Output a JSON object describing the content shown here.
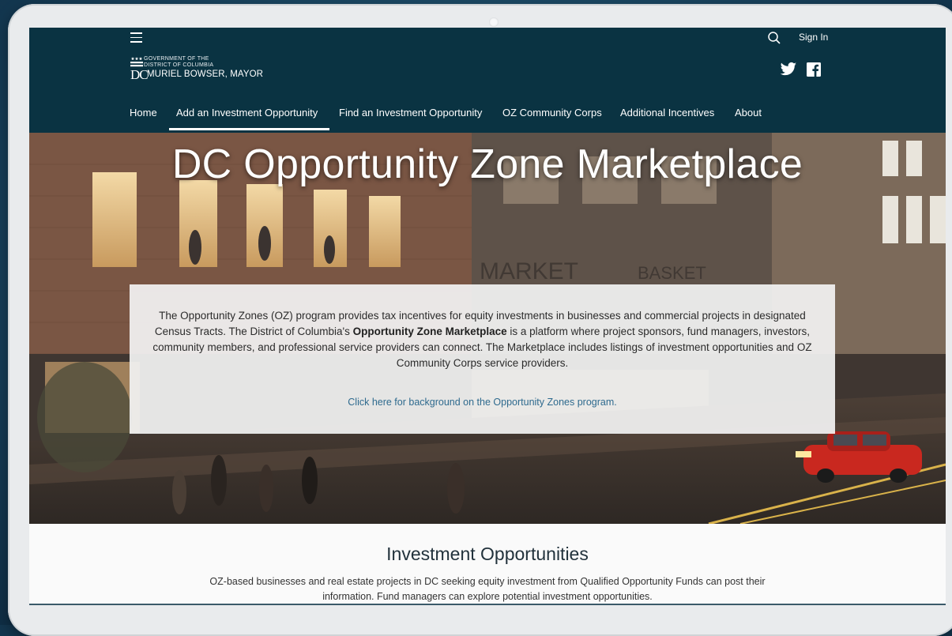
{
  "header": {
    "sign_in": "Sign In",
    "logo": {
      "line1": "GOVERNMENT OF THE",
      "line2": "DISTRICT OF COLUMBIA",
      "dc": "DC",
      "mayor": "MURIEL BOWSER, MAYOR"
    },
    "icons": [
      "menu-icon",
      "search-icon",
      "twitter-icon",
      "facebook-icon"
    ],
    "colors": {
      "header_bg": "#0a3342",
      "link": "#2e6a8e"
    }
  },
  "nav": {
    "items": [
      "Home",
      "Add an Investment Opportunity",
      "Find an Investment Opportunity",
      "OZ Community Corps",
      "Additional Incentives",
      "About"
    ],
    "active": "Add an Investment Opportunity"
  },
  "hero": {
    "title": "DC Opportunity Zone Marketplace",
    "intro_before": "The Opportunity Zones (OZ) program provides tax incentives for equity investments in businesses and commercial projects in designated Census Tracts. The District of Columbia's ",
    "intro_bold": "Opportunity Zone Marketplace",
    "intro_after": " is a platform where project sponsors, fund managers, investors, community members, and professional service providers can connect. The Marketplace includes listings of investment opportunities and OZ Community Corps service providers.",
    "link": "Click here for background on the Opportunity Zones program."
  },
  "section": {
    "title": "Investment Opportunities",
    "description": "OZ-based businesses and real estate projects in DC seeking equity investment from Qualified Opportunity Funds can post their information. Fund managers can explore potential investment opportunities."
  }
}
